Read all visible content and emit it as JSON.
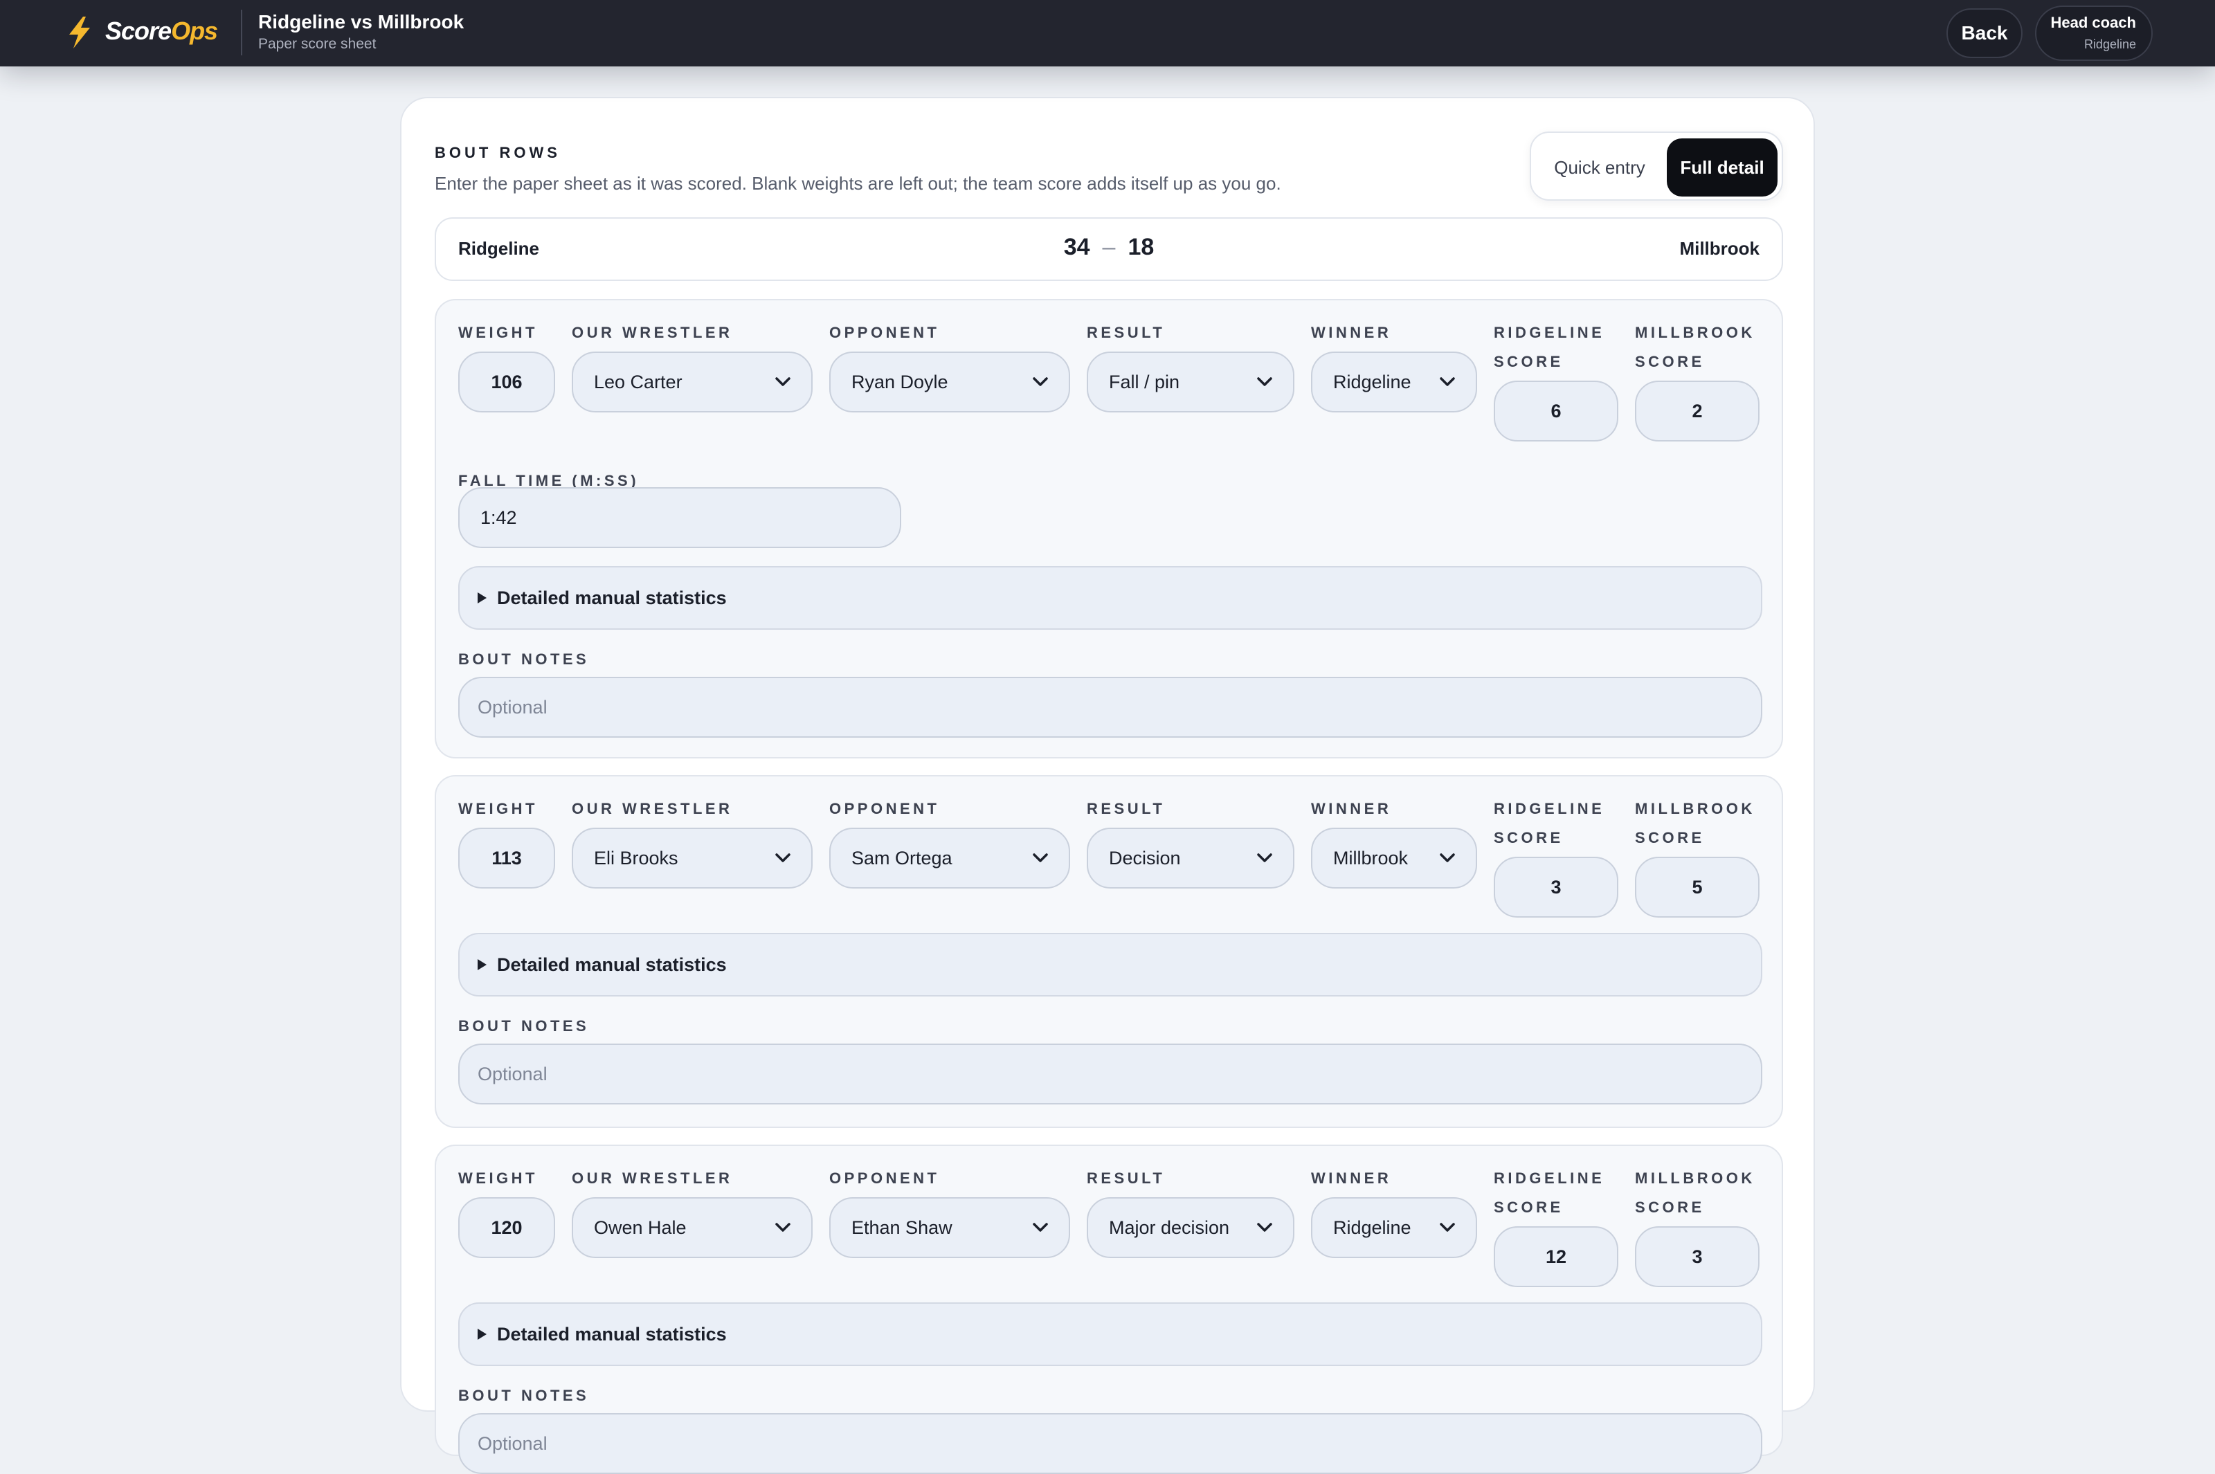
{
  "header": {
    "brand_main": "Score",
    "brand_accent": "Ops",
    "match_title": "Ridgeline vs Millbrook",
    "match_subtitle": "Paper score sheet",
    "back_label": "Back",
    "user_role": "Head coach",
    "user_team": "Ridgeline",
    "accent_color": "#f5b82e"
  },
  "section": {
    "label": "BOUT ROWS",
    "description": "Enter the paper sheet as it was scored. Blank weights are left out; the team score adds itself up as you go.",
    "modes": [
      "Quick entry",
      "Full detail"
    ],
    "active_mode": "Full detail"
  },
  "scoreline": {
    "home_team": "Ridgeline",
    "home_score": "34",
    "separator": "–",
    "away_score": "18",
    "away_team": "Millbrook"
  },
  "labels": {
    "weight": "WEIGHT",
    "our_wrestler": "OUR WRESTLER",
    "opponent": "OPPONENT",
    "result": "RESULT",
    "winner": "WINNER",
    "home_score_1": "RIDGELINE",
    "home_score_2": "SCORE",
    "away_score_1": "MILLBROOK",
    "away_score_2": "SCORE",
    "fall_time": "FALL TIME (M:SS)",
    "details": "Detailed manual statistics",
    "notes": "BOUT NOTES",
    "notes_placeholder": "Optional"
  },
  "bouts": [
    {
      "weight": "106",
      "our_wrestler": "Leo Carter",
      "opponent": "Ryan Doyle",
      "result": "Fall / pin",
      "winner": "Ridgeline",
      "home_score": "6",
      "away_score": "2",
      "fall_time": "1:42"
    },
    {
      "weight": "113",
      "our_wrestler": "Eli Brooks",
      "opponent": "Sam Ortega",
      "result": "Decision",
      "winner": "Millbrook",
      "home_score": "3",
      "away_score": "5"
    },
    {
      "weight": "120",
      "our_wrestler": "Owen Hale",
      "opponent": "Ethan Shaw",
      "result": "Major decision",
      "winner": "Ridgeline",
      "home_score": "12",
      "away_score": "3"
    }
  ]
}
